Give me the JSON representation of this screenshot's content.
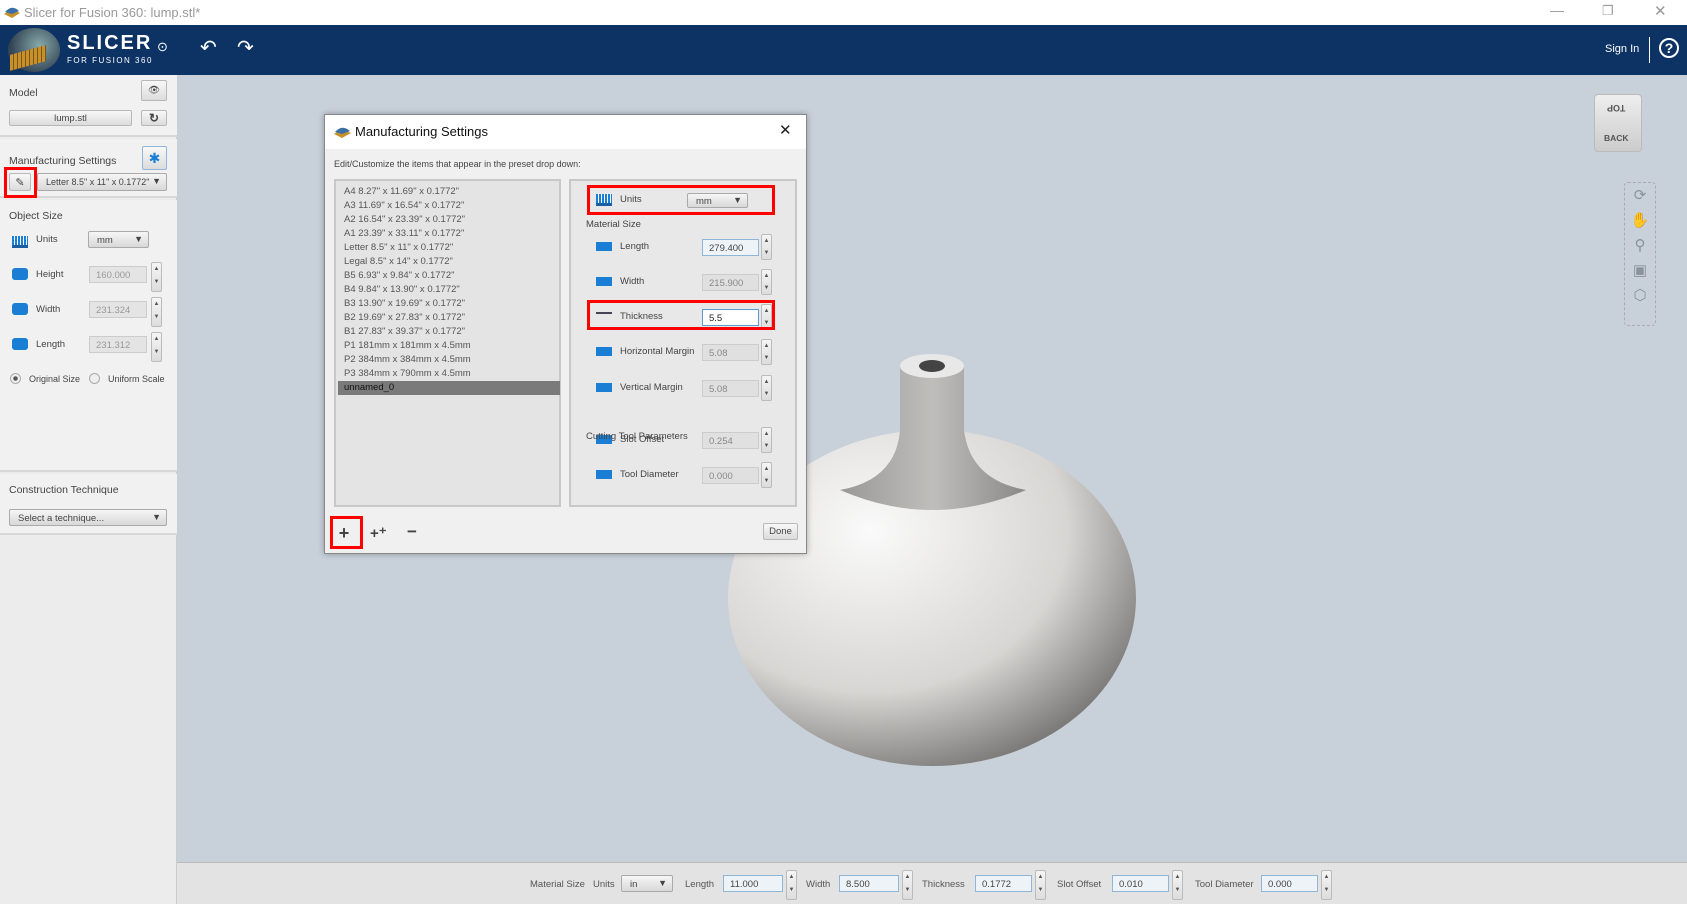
{
  "window": {
    "title": "Slicer for Fusion 360: lump.stl*"
  },
  "header": {
    "logo_main": "SLICER",
    "logo_sub": "FOR FUSION 360",
    "sign_in": "Sign In",
    "help": "?"
  },
  "left": {
    "model_label": "Model",
    "model_file": "lump.stl",
    "mfg_label": "Manufacturing Settings",
    "preset": "Letter 8.5\" x 11\" x 0.1772\"",
    "object_size": "Object Size",
    "units_label": "Units",
    "units_value": "mm",
    "height_label": "Height",
    "height_value": "160.000",
    "width_label": "Width",
    "width_value": "231.324",
    "length_label": "Length",
    "length_value": "231.312",
    "original_size": "Original Size",
    "uniform_scale": "Uniform Scale",
    "construction": "Construction Technique",
    "technique_placeholder": "Select a technique..."
  },
  "dialog": {
    "title": "Manufacturing Settings",
    "close": "✕",
    "instructions": "Edit/Customize the items that appear in the preset drop down:",
    "presets": [
      "A4 8.27\" x 11.69\" x 0.1772\"",
      "A3 11.69\" x 16.54\" x 0.1772\"",
      "A2 16.54\" x 23.39\" x 0.1772\"",
      "A1 23.39\" x 33.11\" x 0.1772\"",
      "Letter 8.5\" x 11\" x 0.1772\"",
      "Legal 8.5\" x 14\" x 0.1772\"",
      "B5 6.93\" x 9.84\" x 0.1772\"",
      "B4 9.84\" x 13.90\" x 0.1772\"",
      "B3 13.90\" x 19.69\" x 0.1772\"",
      "B2 19.69\" x 27.83\" x 0.1772\"",
      "B1 27.83\" x 39.37\" x 0.1772\"",
      "P1 181mm x 181mm x 4.5mm",
      "P2 384mm x 384mm x 4.5mm",
      "P3 384mm x 790mm x 4.5mm",
      "unnamed_0"
    ],
    "units_label": "Units",
    "units_value": "mm",
    "material_size": "Material Size",
    "length_label": "Length",
    "length_value": "279.400",
    "width_label": "Width",
    "width_value": "215.900",
    "thickness_label": "Thickness",
    "thickness_value": "5.5",
    "hmargin_label": "Horizontal Margin",
    "hmargin_value": "5.08",
    "vmargin_label": "Vertical Margin",
    "vmargin_value": "5.08",
    "cutting_tool": "Cutting Tool Parameters",
    "slot_label": "Slot Offset",
    "slot_value": "0.254",
    "tool_label": "Tool Diameter",
    "tool_value": "0.000",
    "add": "+",
    "duplicate": "+⁺",
    "remove": "−",
    "done": "Done"
  },
  "viewcube": {
    "top": "TOP",
    "back": "BACK"
  },
  "bottom": {
    "material_size": "Material Size",
    "units_label": "Units",
    "units_value": "in",
    "length_label": "Length",
    "length_value": "11.000",
    "width_label": "Width",
    "width_value": "8.500",
    "thickness_label": "Thickness",
    "thickness_value": "0.1772",
    "slot_label": "Slot Offset",
    "slot_value": "0.010",
    "tool_label": "Tool Diameter",
    "tool_value": "0.000"
  },
  "colors": {
    "header": "#0d3364",
    "highlight": "#ff0000",
    "accent": "#1a7fd4"
  }
}
